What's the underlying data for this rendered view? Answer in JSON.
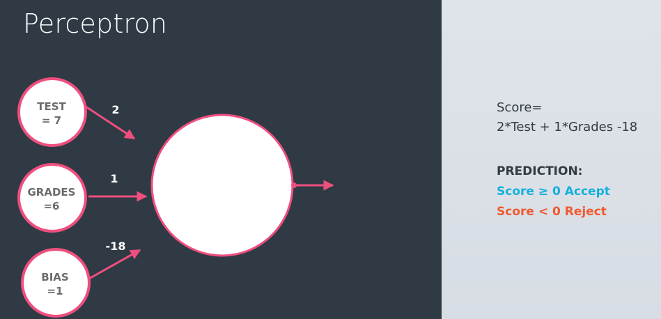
{
  "title": "Perceptron",
  "colors": {
    "background_dark": "#2f3a44",
    "background_light": "#dfe4ea",
    "node_border": "#ef4f7f",
    "edge": "#ef4f7f",
    "accept": "#14b0dc",
    "reject": "#f0582e"
  },
  "diagram": {
    "inputs": [
      {
        "line1": "TEST",
        "line2": "= 7",
        "weight": "2"
      },
      {
        "line1": "GRADES",
        "line2": "=6",
        "weight": "1"
      },
      {
        "line1": "BIAS",
        "line2": "=1",
        "weight": "-18"
      }
    ]
  },
  "formula": {
    "line1": "Score=",
    "line2": "2*Test + 1*Grades -18"
  },
  "prediction": {
    "heading": "PREDICTION:",
    "accept": "Score ≥ 0 Accept",
    "reject": "Score < 0 Reject"
  }
}
